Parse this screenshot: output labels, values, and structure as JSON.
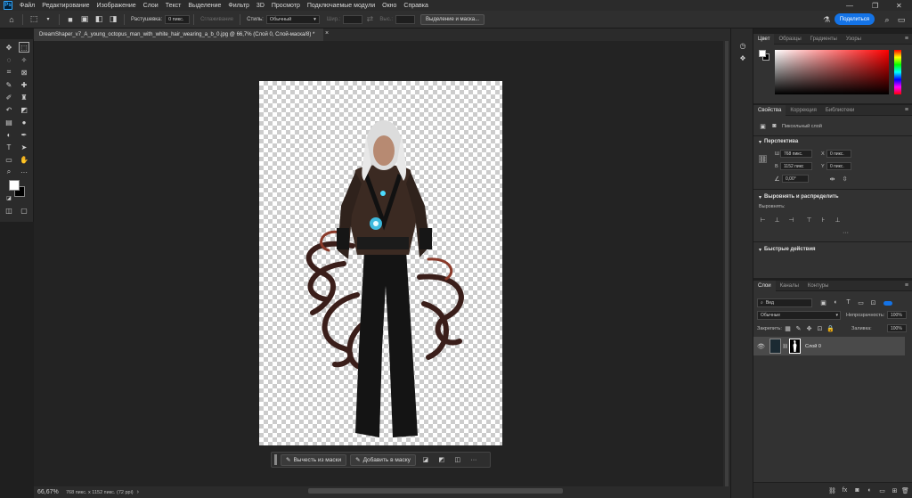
{
  "menu": {
    "items": [
      "Файл",
      "Редактирование",
      "Изображение",
      "Слои",
      "Текст",
      "Выделение",
      "Фильтр",
      "3D",
      "Просмотр",
      "Подключаемые модули",
      "Окно",
      "Справка"
    ]
  },
  "options": {
    "feather_label": "Растушевка:",
    "feather_value": "0 пикс.",
    "antialias_label": "Сглаживание",
    "style_label": "Стиль:",
    "style_value": "Обычный",
    "width_label": "Шир.:",
    "height_label": "Выс.:",
    "select_mask_label": "Выделение и маска...",
    "share_label": "Поделиться"
  },
  "document": {
    "tab_title": "DreamShaper_v7_A_young_octopus_man_with_white_hair_wearing_a_b_0.jpg @ 66,7% (Слой 0, Слой-маска/8) *",
    "close_glyph": "×"
  },
  "mask_bar": {
    "subtract_label": "Вычесть из маски",
    "add_label": "Добавить в маску",
    "more_glyph": "···"
  },
  "status": {
    "zoom": "66,67%",
    "info": "768 пикс. x 1152 пикс. (72 ppi)"
  },
  "color_panel": {
    "tabs": [
      "Цвет",
      "Образцы",
      "Градиенты",
      "Узоры"
    ]
  },
  "properties_panel": {
    "tabs": [
      "Свойства",
      "Коррекция",
      "Библиотеки"
    ],
    "layer_type": "Пиксельный слой",
    "transform_title": "Перспектива",
    "w_label": "Ш",
    "w_value": "768 пикс.",
    "h_label": "В",
    "h_value": "1152 пикс",
    "x_label": "X",
    "x_value": "0 пикс.",
    "y_label": "Y",
    "y_value": "0 пикс.",
    "angle_value": "0,00°",
    "align_title": "Выровнять и распределить",
    "align_sub": "Выровнять:",
    "more_glyph": "···",
    "quick_title": "Быстрые действия"
  },
  "layers_panel": {
    "tabs": [
      "Слои",
      "Каналы",
      "Контуры"
    ],
    "filter_label": "Вид",
    "blend_mode": "Обычные",
    "opacity_label": "Непрозрачность:",
    "opacity_value": "100%",
    "lock_label": "Закрепить:",
    "fill_label": "Заливка:",
    "fill_value": "100%",
    "layer_name": "Слой 0"
  },
  "colors": {
    "accent": "#1473e6",
    "panel": "#323232",
    "background": "#1f1f1f"
  }
}
